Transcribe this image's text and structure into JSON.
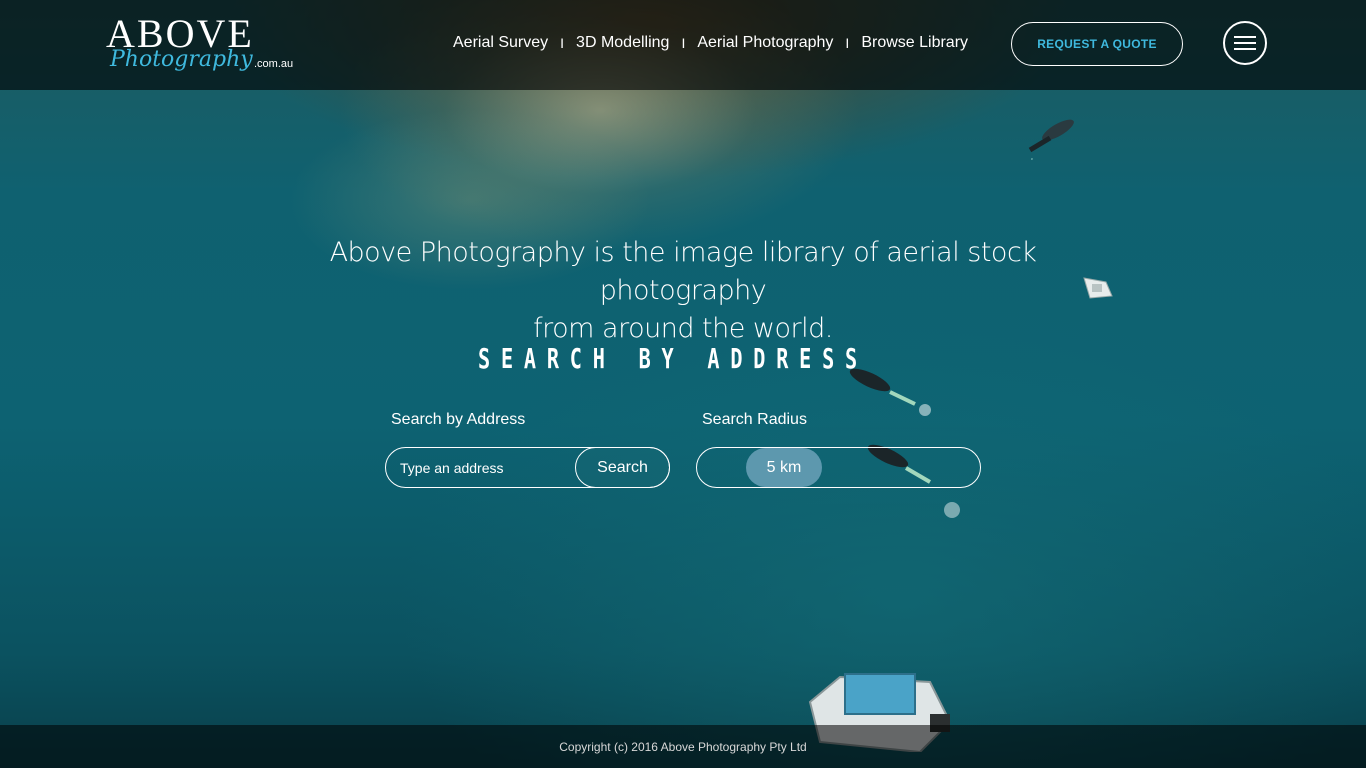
{
  "logo": {
    "main": "ABOVE",
    "script": "Photography",
    "domain": ".com.au"
  },
  "nav": {
    "items": [
      "Aerial Survey",
      "3D Modelling",
      "Aerial Photography",
      "Browse Library"
    ],
    "separator": "I"
  },
  "header": {
    "quote_label": "REQUEST A QUOTE",
    "menu_icon": "hamburger-menu-icon"
  },
  "hero": {
    "tagline_line1": "Above Photography is the image library of aerial stock photography",
    "tagline_line2": "from around the world.",
    "section_title": "SEARCH BY ADDRESS"
  },
  "search": {
    "address_label": "Search by Address",
    "address_placeholder": "Type an address",
    "button_label": "Search",
    "radius_label": "Search Radius",
    "radius_value": "5 km"
  },
  "footer": {
    "copyright": "Copyright (c) 2016 Above Photography Pty Ltd"
  },
  "colors": {
    "accent": "#3fb9de",
    "header_bg": "#000000",
    "slider_thumb": "#78aac3"
  }
}
